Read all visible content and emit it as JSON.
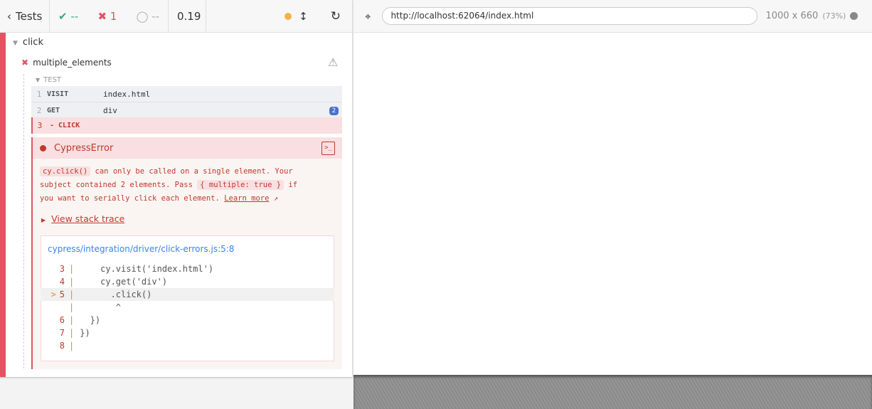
{
  "reporter": {
    "back_label": "Tests",
    "passed": "--",
    "failed": "1",
    "pending": "--",
    "duration": "0.19",
    "suite": "click",
    "test": "multiple_elements",
    "section": "TEST",
    "commands": [
      {
        "num": "1",
        "name": "VISIT",
        "msg": "index.html"
      },
      {
        "num": "2",
        "name": "GET",
        "msg": "div",
        "badge": "2"
      },
      {
        "num": "3",
        "name": "- CLICK",
        "msg": ""
      }
    ],
    "error": {
      "title": "CypressError",
      "code1": "cy.click()",
      "text1": " can only be called on a single element. Your",
      "text2": "subject contained 2 elements. Pass ",
      "code2": "{ multiple: true }",
      "text3": " if",
      "text4": "you want to serially click each element. ",
      "learn_more": "Learn more",
      "stack_trace": "View stack trace",
      "file": "cypress/integration/driver/click-errors.js:5:8",
      "lines": [
        {
          "n": "3",
          "code": "    cy.visit('index.html')"
        },
        {
          "n": "4",
          "code": "    cy.get('div')"
        },
        {
          "n": "5",
          "code": "      .click()",
          "marker": ">"
        },
        {
          "n": "",
          "code": "       ^"
        },
        {
          "n": "6",
          "code": "  })"
        },
        {
          "n": "7",
          "code": "})"
        },
        {
          "n": "8",
          "code": ""
        }
      ]
    }
  },
  "browser": {
    "url": "http://localhost:62064/index.html",
    "viewport": "1000 x 660",
    "scale": "(73%)"
  },
  "colors": {
    "accent_fail": "#e05561",
    "pass": "#3aa87d",
    "pending_dot": "#f5b142",
    "link": "#3a82e8"
  }
}
